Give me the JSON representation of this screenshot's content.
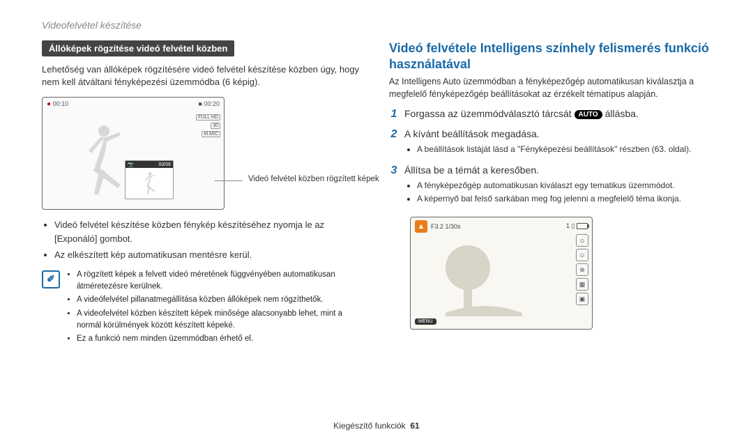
{
  "page_header": "Videofelvétel készítése",
  "left": {
    "badge": "Állóképek rögzítése videó felvétel közben",
    "intro": "Lehetőség van állóképek rögzítésére videó felvétel készítése közben úgy, hogy nem kell átváltani fényképezési üzemmódba (6 képig).",
    "screen": {
      "rec_time": "00:10",
      "total_time": "00:20",
      "badge1": "FULL HD",
      "badge2": "30",
      "badge3": "M.MIC",
      "thumb_counter": "03/06"
    },
    "caption": "Videó felvétel közben rögzített képek",
    "bullets": [
      "Videó felvétel készítése közben fénykép készítéséhez nyomja le az [Exponáló] gombot.",
      "Az elkészített kép automatikusan mentésre kerül."
    ],
    "bullet_bold_word": "Exponáló",
    "notes": [
      "A rögzített képek a felvett videó méretének függvényében automatikusan átméretezésre kerülnek.",
      "A videófelvétel pillanatmegállítása közben állóképek nem rögzíthetők.",
      "A videofelvétel közben készített képek minősége alacsonyabb lehet, mint a normál körülmények között készített képeké.",
      "Ez a funkció nem minden üzemmódban érhető el."
    ],
    "note_icon_text": "✐"
  },
  "right": {
    "heading": "Videó felvétele Intelligens színhely felismerés funkció használatával",
    "intro": "Az Intelligens Auto üzemmódban a fényképezőgép automatikusan kiválasztja a megfelelő fényképezőgép beállításokat az érzékelt tématípus alapján.",
    "steps": [
      {
        "num": "1",
        "text_before": "Forgassa az üzemmódválasztó tárcsát ",
        "pill": "AUTO",
        "text_after": " állásba."
      },
      {
        "num": "2",
        "text": "A kívánt beállítások megadása.",
        "sub": [
          "A beállítások listáját lásd a \"Fényképezési beállítások\" részben (63. oldal)."
        ]
      },
      {
        "num": "3",
        "text": "Állítsa be a témát a keresőben.",
        "sub": [
          "A fényképezőgép automatikusan kiválaszt egy tematikus üzemmódot.",
          "A képernyő bal felső sarkában meg fog jelenni a megfelelő téma ikonja."
        ]
      }
    ],
    "screen": {
      "fval": "F3.2 1/30s",
      "count": "1",
      "menu": "MENU"
    }
  },
  "footer": {
    "section": "Kiegészítő funkciók",
    "page": "61"
  }
}
